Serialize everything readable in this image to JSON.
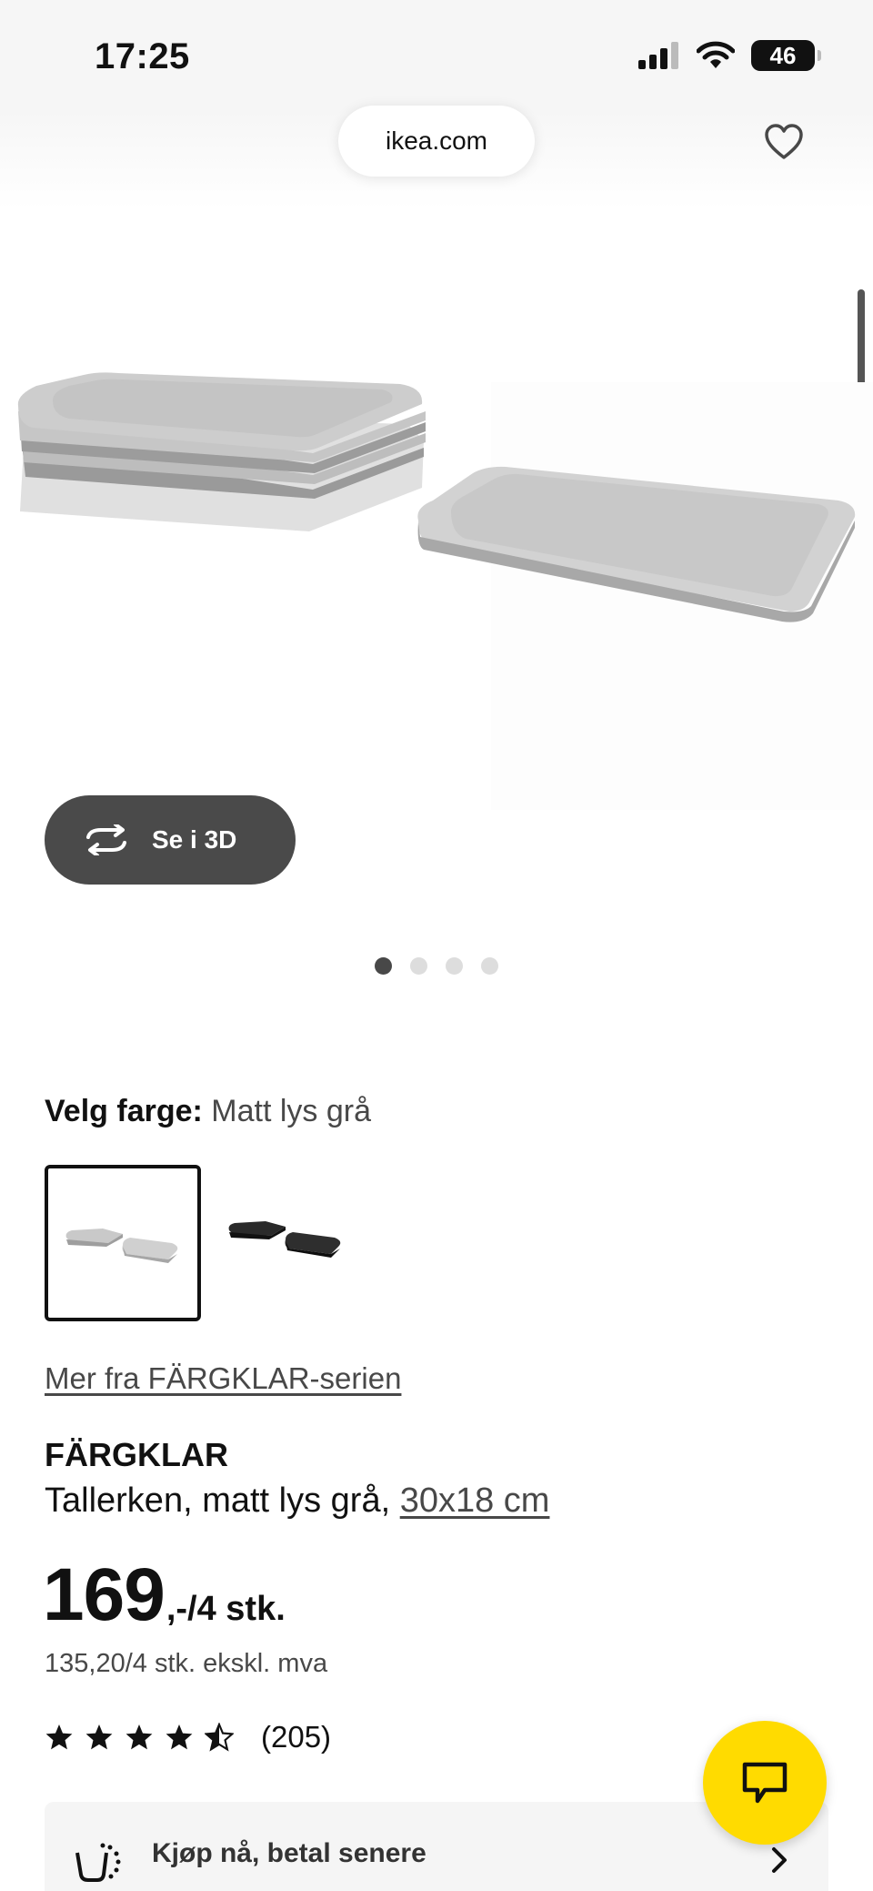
{
  "status_bar": {
    "time": "17:25",
    "battery": "46"
  },
  "browser": {
    "url": "ikea.com"
  },
  "gallery": {
    "view_3d_label": "Se i 3D",
    "page_count": 4,
    "active_page": 1
  },
  "color_picker": {
    "label": "Velg farge:",
    "selected_value": "Matt lys grå",
    "options": [
      "light-grey-plates",
      "black-plates"
    ]
  },
  "series_link": "Mer fra FÄRGKLAR-serien",
  "product": {
    "name": "FÄRGKLAR",
    "description": "Tallerken, matt lys grå,",
    "size_link": "30x18 cm",
    "price": "169",
    "price_suffix": ",-/4 stk.",
    "price_ex_vat": "135,20/4 stk. ekskl. mva",
    "rating_stars": 4.5,
    "rating_count": "(205)"
  },
  "bnpl": {
    "label": "Kjøp nå, betal senere"
  },
  "colors": {
    "accent_yellow": "#ffdb00",
    "dark_button": "#4a4a4a",
    "text": "#111111"
  }
}
